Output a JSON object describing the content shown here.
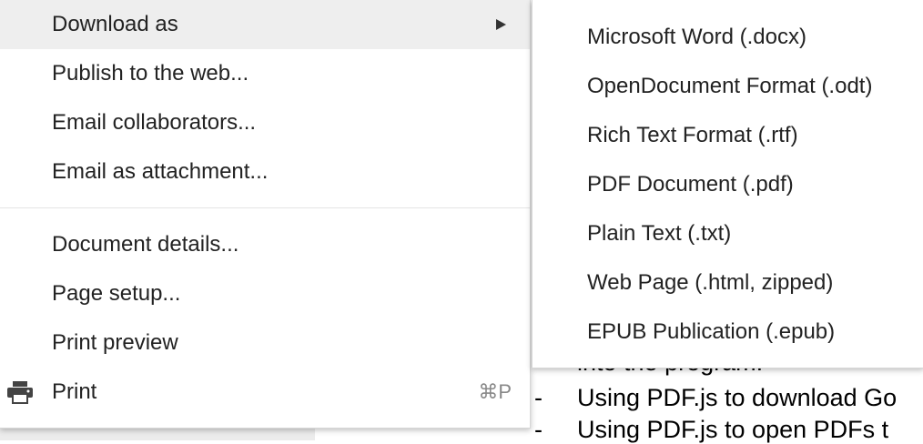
{
  "file_menu": {
    "items": [
      {
        "label": "Download as",
        "has_submenu": true,
        "highlighted": true
      },
      {
        "label": "Publish to the web..."
      },
      {
        "label": "Email collaborators..."
      },
      {
        "label": "Email as attachment..."
      },
      {
        "label": "Document details..."
      },
      {
        "label": "Page setup..."
      },
      {
        "label": "Print preview"
      },
      {
        "label": "Print",
        "shortcut": "⌘P",
        "icon": "printer-icon"
      }
    ]
  },
  "download_submenu": {
    "items": [
      {
        "label": "Microsoft Word (.docx)"
      },
      {
        "label": "OpenDocument Format (.odt)"
      },
      {
        "label": "Rich Text Format (.rtf)"
      },
      {
        "label": "PDF Document (.pdf)"
      },
      {
        "label": "Plain Text (.txt)"
      },
      {
        "label": "Web Page (.html, zipped)"
      },
      {
        "label": "EPUB Publication (.epub)"
      }
    ]
  },
  "document": {
    "lines": [
      {
        "text": "into the program."
      },
      {
        "bullet": "-",
        "text": "Using PDF.js to download Go"
      },
      {
        "bullet": "-",
        "text": "Using PDF.js to open PDFs t"
      }
    ]
  },
  "colors": {
    "highlight": "#eeeeee",
    "text": "#222222",
    "shortcut": "#888888"
  }
}
